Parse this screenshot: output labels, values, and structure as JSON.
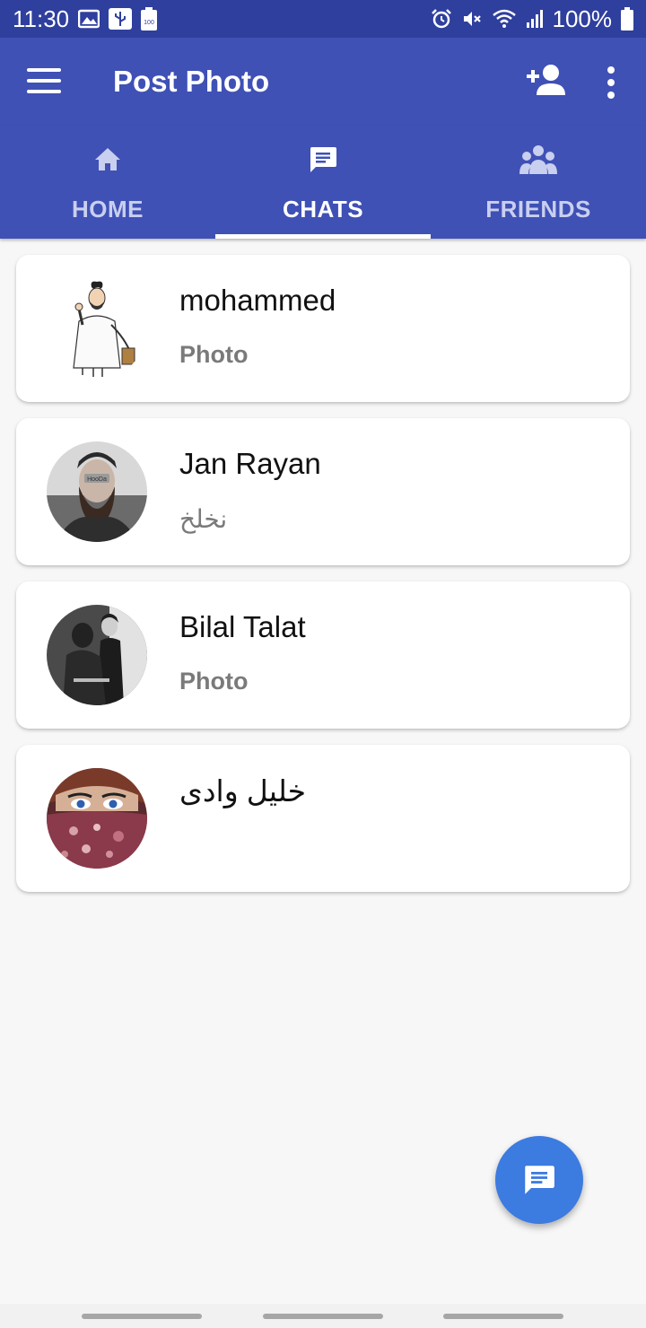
{
  "status_bar": {
    "time": "11:30",
    "battery_percent": "100%",
    "battery_mini_text": "100",
    "icons": [
      "gallery-icon",
      "usb-icon",
      "battery-saver-icon",
      "alarm-icon",
      "mute-icon",
      "wifi-icon",
      "signal-icon",
      "battery-icon"
    ]
  },
  "app_bar": {
    "title": "Post Photo",
    "icons": [
      "menu-icon",
      "add-friend-icon",
      "more-vert-icon"
    ]
  },
  "tabs": [
    {
      "label": "HOME",
      "icon": "home-icon",
      "active": false
    },
    {
      "label": "CHATS",
      "icon": "chat-icon",
      "active": true
    },
    {
      "label": "FRIENDS",
      "icon": "group-icon",
      "active": false
    }
  ],
  "chats": [
    {
      "name": "mohammed",
      "last_message": "Photo"
    },
    {
      "name": "Jan Rayan",
      "last_message": "نخلخ"
    },
    {
      "name": "Bilal Talat",
      "last_message": "Photo"
    },
    {
      "name": "خليل وادى",
      "last_message": ""
    }
  ],
  "avatar_badge_text": "HooDa",
  "fab": {
    "icon": "message-icon"
  },
  "colors": {
    "status_bar": "#2f3f9e",
    "primary": "#3f51b5",
    "fab": "#3c7be0",
    "background": "#f7f7f7"
  }
}
